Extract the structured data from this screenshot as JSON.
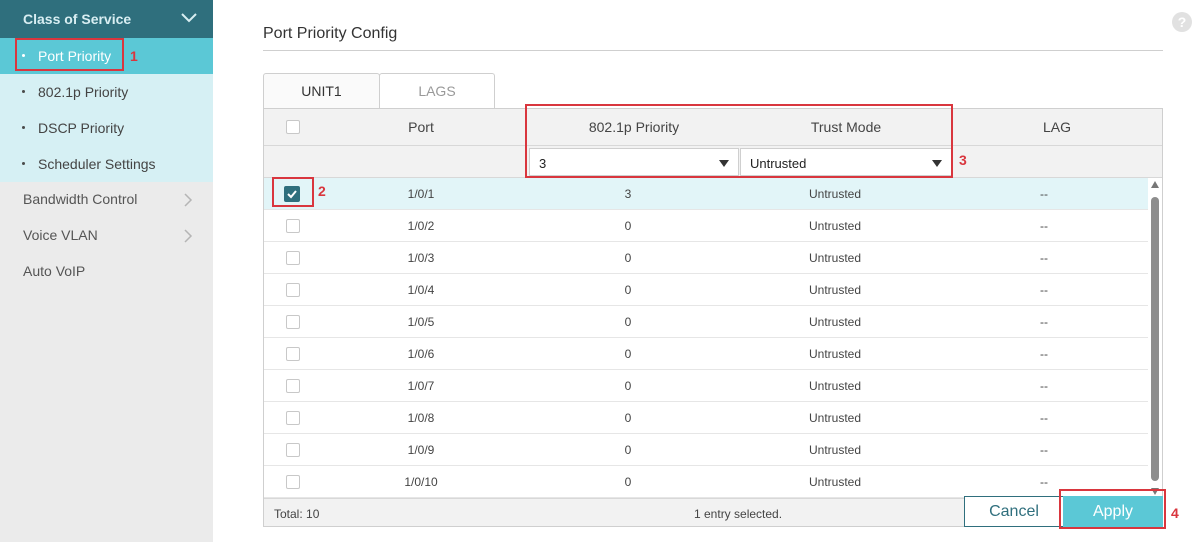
{
  "sidebar": {
    "section_title": "Class of Service",
    "sub_items": [
      {
        "label": "Port Priority",
        "active": true
      },
      {
        "label": "802.1p Priority",
        "active": false
      },
      {
        "label": "DSCP Priority",
        "active": false
      },
      {
        "label": "Scheduler Settings",
        "active": false
      }
    ],
    "main_items": [
      {
        "label": "Bandwidth Control",
        "has_arrow": true
      },
      {
        "label": "Voice VLAN",
        "has_arrow": true
      },
      {
        "label": "Auto VoIP",
        "has_arrow": false
      }
    ]
  },
  "page": {
    "title": "Port Priority Config",
    "help_icon": "?"
  },
  "tabs": [
    {
      "label": "UNIT1",
      "active": true
    },
    {
      "label": "LAGS",
      "active": false
    }
  ],
  "table": {
    "headers": {
      "port": "Port",
      "priority": "802.1p Priority",
      "trust_mode": "Trust Mode",
      "lag": "LAG"
    },
    "filter": {
      "priority_value": "3",
      "trust_mode_value": "Untrusted"
    },
    "rows": [
      {
        "port": "1/0/1",
        "priority": "3",
        "trust_mode": "Untrusted",
        "lag": "--",
        "checked": true
      },
      {
        "port": "1/0/2",
        "priority": "0",
        "trust_mode": "Untrusted",
        "lag": "--",
        "checked": false
      },
      {
        "port": "1/0/3",
        "priority": "0",
        "trust_mode": "Untrusted",
        "lag": "--",
        "checked": false
      },
      {
        "port": "1/0/4",
        "priority": "0",
        "trust_mode": "Untrusted",
        "lag": "--",
        "checked": false
      },
      {
        "port": "1/0/5",
        "priority": "0",
        "trust_mode": "Untrusted",
        "lag": "--",
        "checked": false
      },
      {
        "port": "1/0/6",
        "priority": "0",
        "trust_mode": "Untrusted",
        "lag": "--",
        "checked": false
      },
      {
        "port": "1/0/7",
        "priority": "0",
        "trust_mode": "Untrusted",
        "lag": "--",
        "checked": false
      },
      {
        "port": "1/0/8",
        "priority": "0",
        "trust_mode": "Untrusted",
        "lag": "--",
        "checked": false
      },
      {
        "port": "1/0/9",
        "priority": "0",
        "trust_mode": "Untrusted",
        "lag": "--",
        "checked": false
      },
      {
        "port": "1/0/10",
        "priority": "0",
        "trust_mode": "Untrusted",
        "lag": "--",
        "checked": false
      }
    ],
    "total": "Total: 10",
    "selection": "1 entry selected."
  },
  "buttons": {
    "cancel": "Cancel",
    "apply": "Apply"
  },
  "callouts": [
    "1",
    "2",
    "3",
    "4"
  ],
  "colors": {
    "accent": "#5bc8d6",
    "header": "#2f6f7d",
    "callout": "#d9363e"
  }
}
